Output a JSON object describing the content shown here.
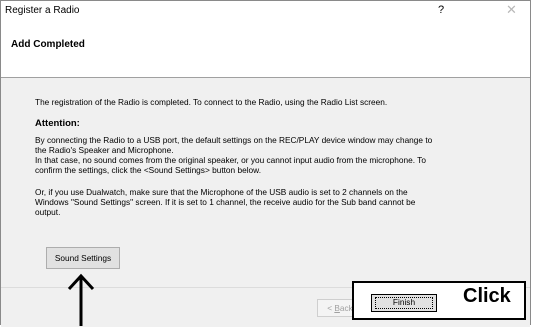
{
  "window": {
    "title": "Register a Radio",
    "help_glyph": "?",
    "close_glyph": "✕"
  },
  "header": {
    "title": "Add Completed"
  },
  "content": {
    "intro": "The registration of the Radio is completed. To connect to the Radio, using the Radio List screen.",
    "attention_heading": "Attention:",
    "para1_line1": "By connecting the Radio to a USB port, the default settings on the REC/PLAY device window may change to",
    "para1_line2": "the Radio's Speaker and Microphone.",
    "para1_line3": "In that case, no sound comes from the original speaker, or you cannot input audio from the microphone. To",
    "para1_line4": "confirm the settings, click the <Sound Settings> button below.",
    "para2_line1": "Or, if you use Dualwatch, make sure that the Microphone of the USB audio is set to 2 channels on the",
    "para2_line2": "Windows \"Sound Settings\" screen. If it is set to 1 channel, the receive audio for the Sub band cannot be",
    "para2_line3": "output."
  },
  "buttons": {
    "sound_settings": "Sound Settings",
    "back_prefix": "< ",
    "back_mnemonic": "B",
    "back_rest": "ack",
    "finish": "Finish"
  },
  "annotation": {
    "click_label": "Click",
    "arrow_icon": "up-arrow-icon"
  }
}
